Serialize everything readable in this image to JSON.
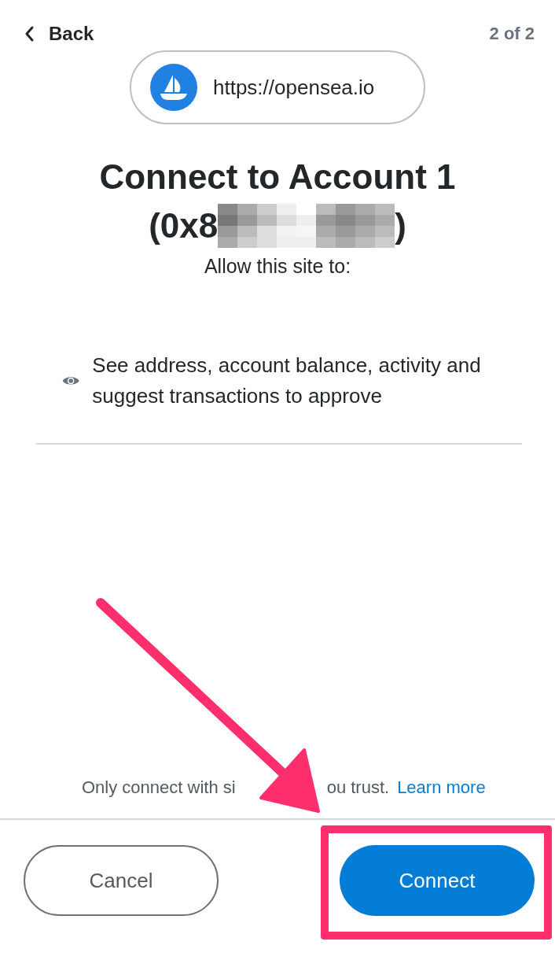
{
  "header": {
    "back_label": "Back",
    "step": "2 of 2"
  },
  "site": {
    "url": "https://opensea.io"
  },
  "title": {
    "line_1": "Connect to Account 1",
    "address_prefix": "(0x8",
    "address_suffix": ")"
  },
  "subtitle": "Allow this site to:",
  "permissions": [
    {
      "text": "See address, account balance, activity and suggest transactions to approve"
    }
  ],
  "footer_note": {
    "text_before": "Only connect with si",
    "text_after": "ou trust.",
    "link": "Learn more"
  },
  "buttons": [
    {
      "label": "Cancel",
      "kind": "secondary"
    },
    {
      "label": "Connect",
      "kind": "primary",
      "highlighted": true
    }
  ]
}
